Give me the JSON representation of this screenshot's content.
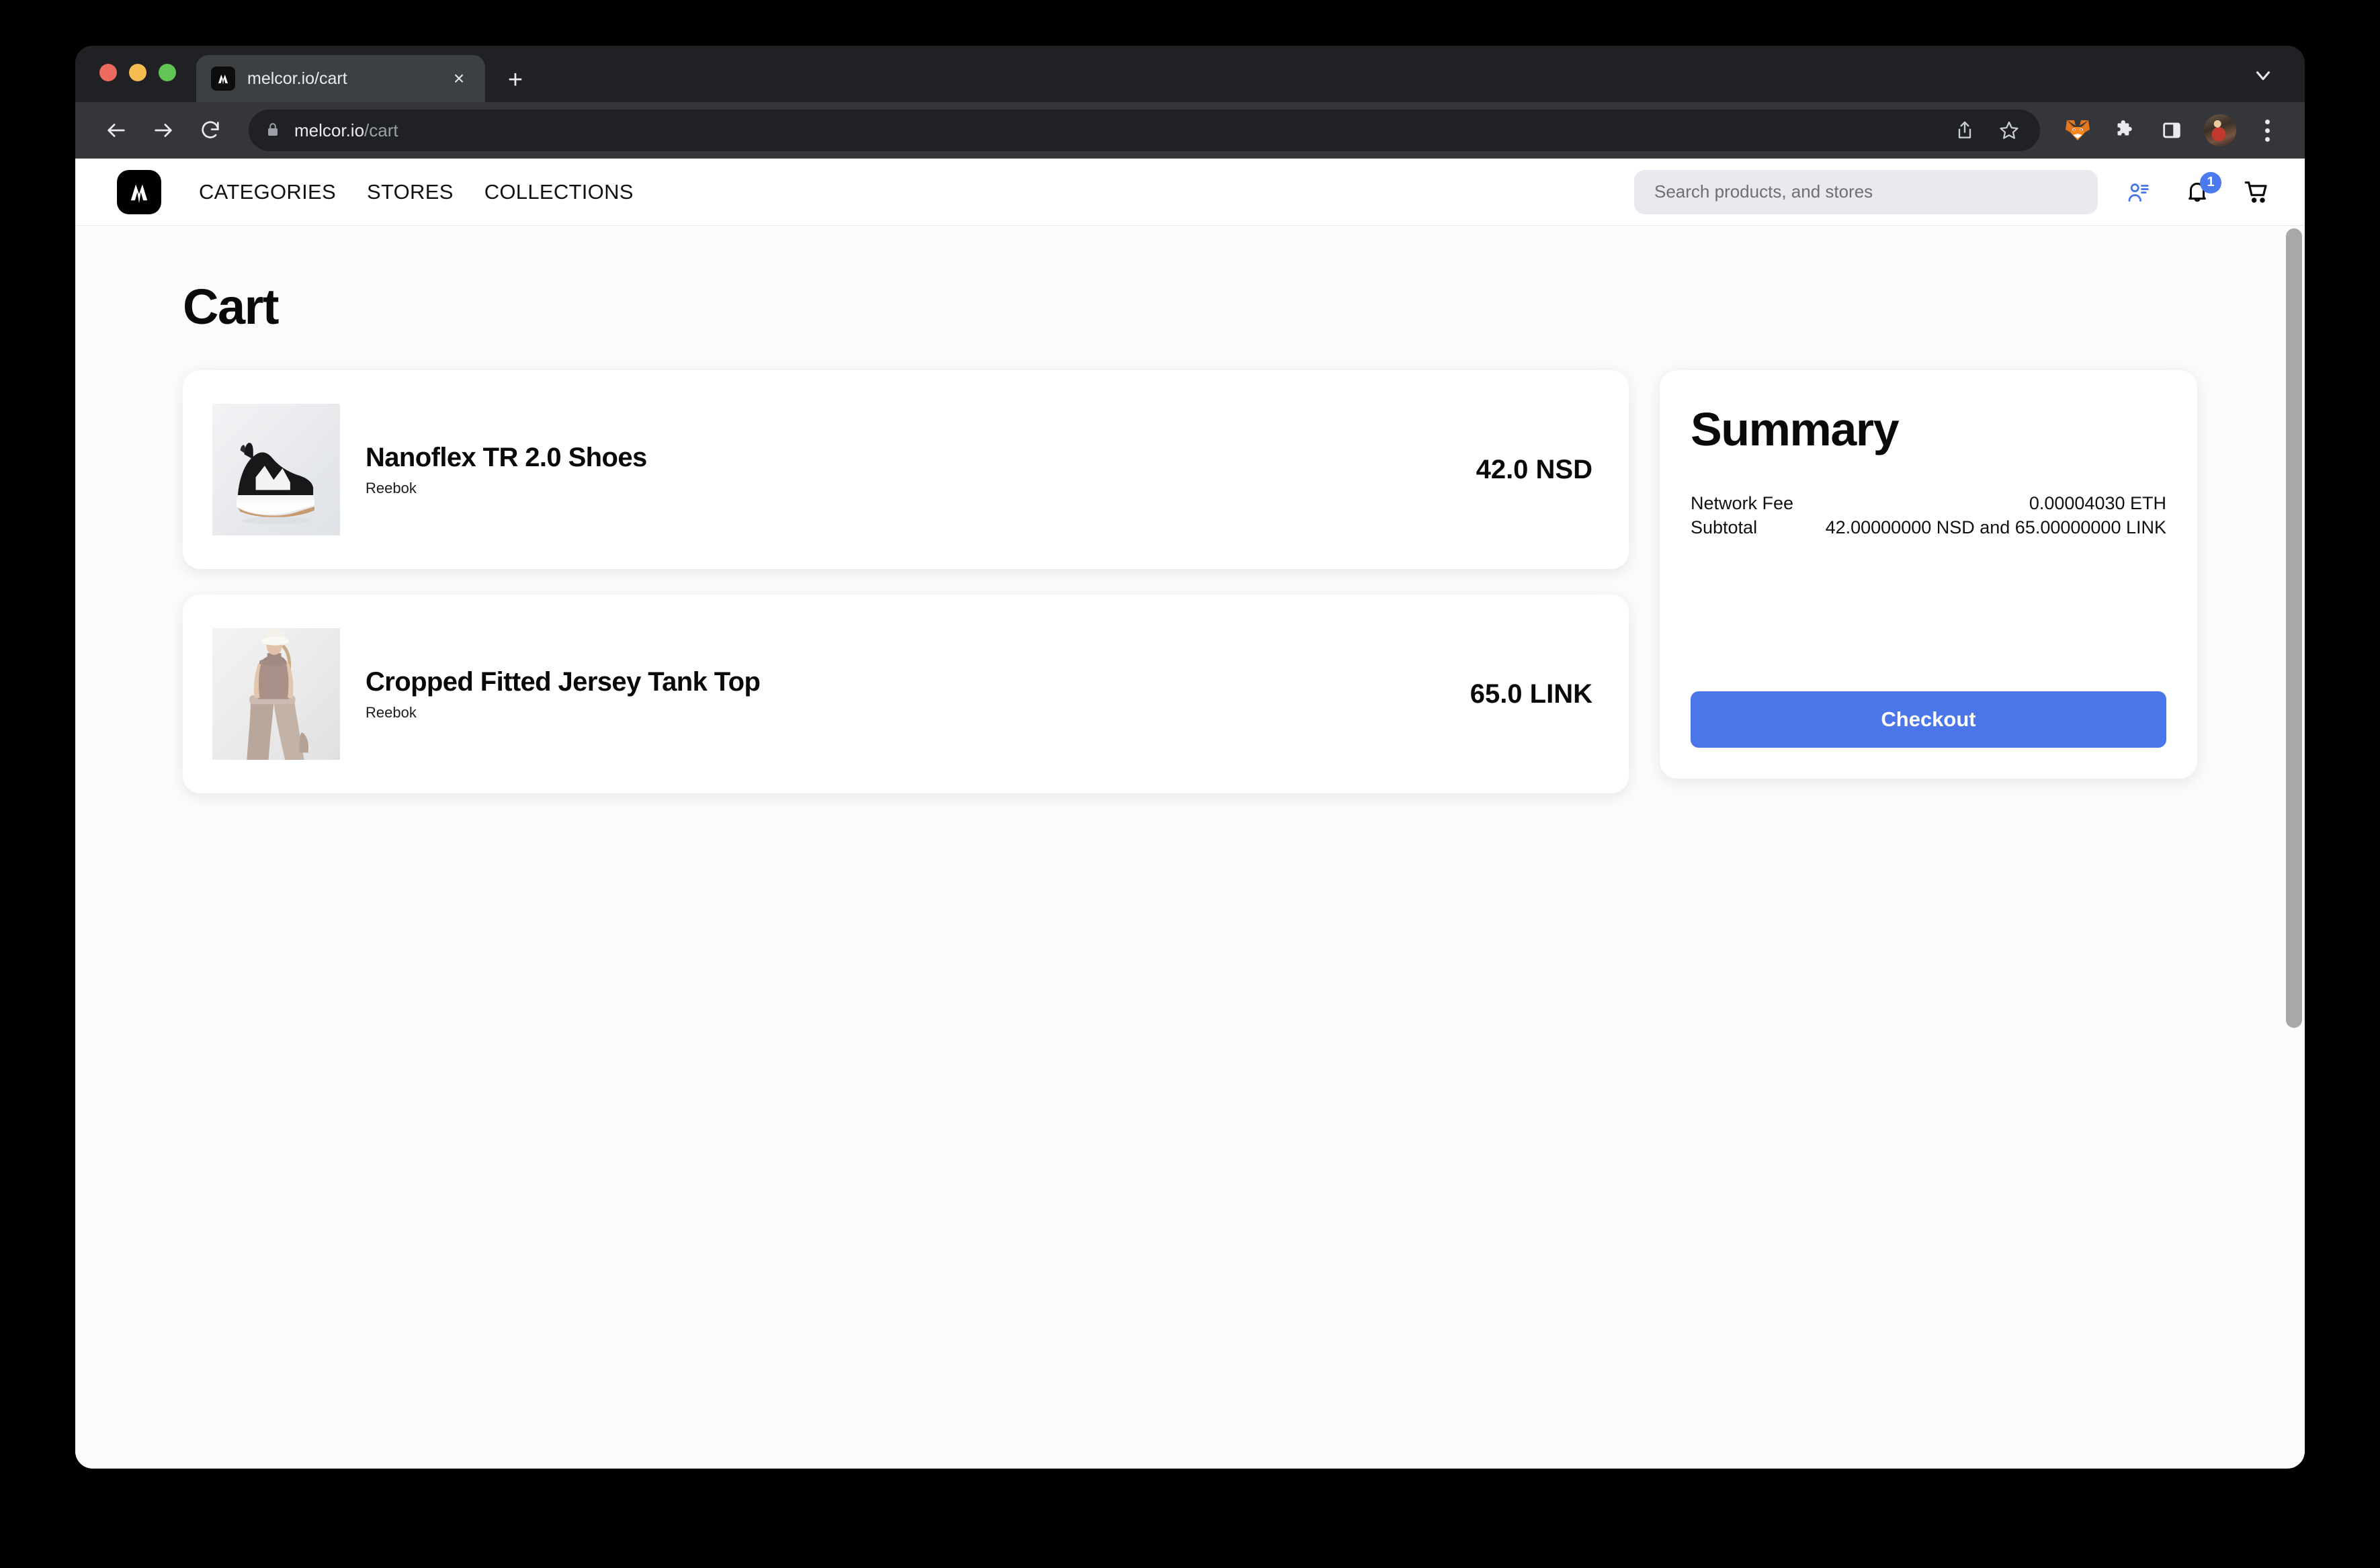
{
  "browser": {
    "tab": {
      "title": "melcor.io/cart",
      "favicon": "melcor-logo-icon",
      "close_label": "×"
    },
    "new_tab_label": "+",
    "nav": {
      "back": "back-arrow",
      "forward": "forward-arrow",
      "reload": "reload-arrow"
    },
    "omnibox": {
      "url_domain": "melcor.io",
      "url_path": "/cart",
      "lock": "lock-icon"
    },
    "toolbar_icons": [
      "share-icon",
      "bookmark-star-icon",
      "metamask-fox-icon",
      "extensions-puzzle-icon",
      "side-panel-icon",
      "profile-avatar",
      "more-menu-icon"
    ]
  },
  "site": {
    "brand": "melcor-logo",
    "nav": [
      {
        "label": "CATEGORIES",
        "name": "nav-categories"
      },
      {
        "label": "STORES",
        "name": "nav-stores"
      },
      {
        "label": "COLLECTIONS",
        "name": "nav-collections"
      }
    ],
    "search": {
      "placeholder": "Search products, and stores",
      "value": ""
    },
    "icons": {
      "account": "user-list-icon",
      "notifications": "bell-icon",
      "notification_count": "1",
      "cart": "shopping-cart-icon"
    },
    "accent_blue": "#4a76ea",
    "badge_blue": "#4a7aed"
  },
  "page": {
    "title": "Cart"
  },
  "cart": {
    "items": [
      {
        "name": "Nanoflex TR 2.0 Shoes",
        "brand": "Reebok",
        "price": "42.0 NSD",
        "thumb": "black-sneaker-photo"
      },
      {
        "name": "Cropped Fitted Jersey Tank Top",
        "brand": "Reebok",
        "price": "65.0 LINK",
        "thumb": "model-beige-outfit-photo"
      }
    ]
  },
  "summary": {
    "title": "Summary",
    "rows": [
      {
        "label": "Network Fee",
        "value": "0.00004030 ETH"
      },
      {
        "label": "Subtotal",
        "value": "42.00000000 NSD and 65.00000000 LINK"
      }
    ],
    "checkout_label": "Checkout"
  }
}
